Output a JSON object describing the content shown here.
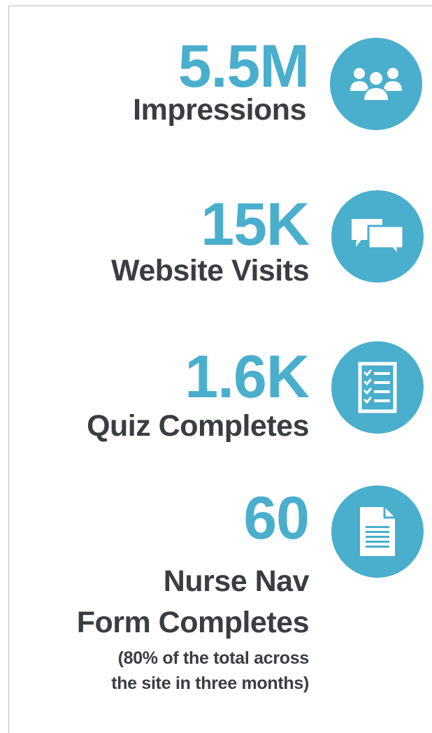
{
  "colors": {
    "accent": "#4aaecd",
    "text": "#3a3d42",
    "background": "#ffffff"
  },
  "stats": [
    {
      "value": "5.5M",
      "label": "Impressions",
      "icon": "people-icon"
    },
    {
      "value": "15K",
      "label": "Website Visits",
      "icon": "chat-bubbles-icon"
    },
    {
      "value": "1.6K",
      "label": "Quiz Completes",
      "icon": "checklist-icon"
    },
    {
      "value": "60",
      "label_line1": "Nurse Nav",
      "label_line2": "Form Completes",
      "note_line1": "(80% of the total across",
      "note_line2": "the site in three months)",
      "icon": "document-icon"
    }
  ]
}
